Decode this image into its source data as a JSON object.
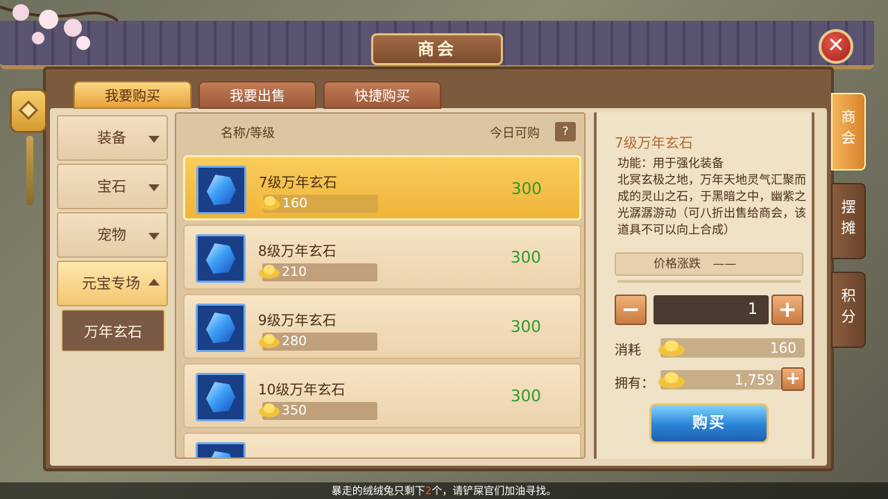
{
  "window": {
    "title": "商会",
    "close_icon": "close-icon"
  },
  "top_tabs": [
    {
      "label": "我要购买",
      "active": true
    },
    {
      "label": "我要出售",
      "active": false
    },
    {
      "label": "快捷购买",
      "active": false
    }
  ],
  "categories": [
    {
      "label": "装备",
      "expanded": false
    },
    {
      "label": "宝石",
      "expanded": false
    },
    {
      "label": "宠物",
      "expanded": false
    },
    {
      "label": "元宝专场",
      "expanded": true
    }
  ],
  "subcategory": {
    "label": "万年玄石",
    "selected": true
  },
  "list": {
    "header_name": "名称/等级",
    "header_today": "今日可购",
    "help_label": "?",
    "items": [
      {
        "name": "7级万年玄石",
        "price": "160",
        "available": "300",
        "selected": true
      },
      {
        "name": "8级万年玄石",
        "price": "210",
        "available": "300",
        "selected": false
      },
      {
        "name": "9级万年玄石",
        "price": "280",
        "available": "300",
        "selected": false
      },
      {
        "name": "10级万年玄石",
        "price": "350",
        "available": "300",
        "selected": false
      }
    ]
  },
  "detail": {
    "title": "7级万年玄石",
    "description": "功能：用于强化装备\n北冥玄极之地，万年天地灵气汇聚而成的灵山之石，于黑暗之中，幽紫之光潺潺游动（可八折出售给商会，该道具不可以向上合成）",
    "trend_label": "价格涨跌",
    "trend_value": "——",
    "quantity": "1",
    "minus_label": "−",
    "plus_label": "+",
    "cost_label": "消耗",
    "cost_value": "160",
    "owned_label": "拥有：",
    "owned_value": "1,759",
    "add_label": "+",
    "buy_label": "购买"
  },
  "side_tabs": [
    {
      "label": "商会",
      "active": true
    },
    {
      "label": "摆摊",
      "active": false
    },
    {
      "label": "积分",
      "active": false
    }
  ],
  "ticker": {
    "before": "暴走的绒绒兔只剩下",
    "highlight": "2",
    "after": "个，请铲屎官们加油寻找。"
  },
  "colors": {
    "available_green": "#2f9a2f",
    "accent_gold": "#f0b439",
    "highlight_red": "#ff4a3a"
  }
}
